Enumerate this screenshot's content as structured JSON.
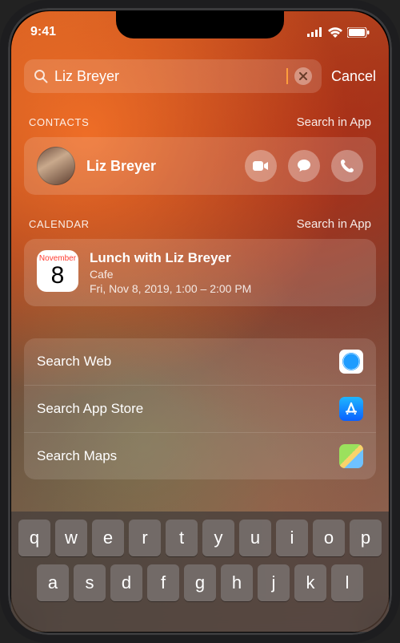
{
  "status": {
    "time": "9:41"
  },
  "search": {
    "query": "Liz Breyer",
    "cancel": "Cancel"
  },
  "sections": {
    "contacts": {
      "title": "CONTACTS",
      "link": "Search in App",
      "result": {
        "name": "Liz Breyer"
      }
    },
    "calendar": {
      "title": "CALENDAR",
      "link": "Search in App",
      "event": {
        "month": "November",
        "day": "8",
        "title": "Lunch with Liz Breyer",
        "location": "Cafe",
        "time": "Fri, Nov 8, 2019, 1:00 – 2:00 PM"
      }
    }
  },
  "suggestions": {
    "web": "Search Web",
    "appstore": "Search App Store",
    "maps": "Search Maps"
  },
  "keyboard": {
    "row1": [
      "q",
      "w",
      "e",
      "r",
      "t",
      "y",
      "u",
      "i",
      "o",
      "p"
    ],
    "row2": [
      "a",
      "s",
      "d",
      "f",
      "g",
      "h",
      "j",
      "k",
      "l"
    ]
  }
}
